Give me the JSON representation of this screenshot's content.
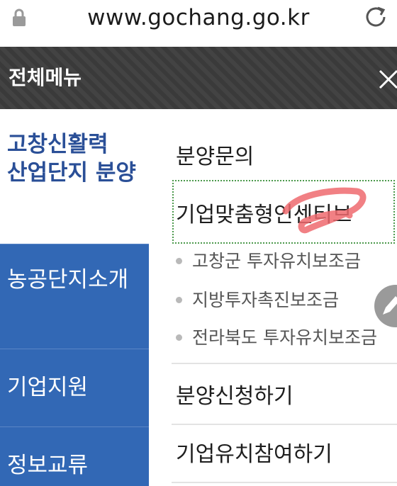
{
  "browser": {
    "url": "www.gochang.go.kr"
  },
  "menu": {
    "title": "전체메뉴"
  },
  "left_nav": {
    "active": "고창신활력 산업단지 분양",
    "items": [
      {
        "label": "농공단지소개"
      },
      {
        "label": "기업지원"
      },
      {
        "label": "정보교류"
      }
    ]
  },
  "right_nav": {
    "items": [
      {
        "label": "분양문의"
      },
      {
        "label": "기업맞춤형인센티브"
      },
      {
        "label": "분양신청하기"
      },
      {
        "label": "기업유치참여하기"
      }
    ],
    "subitems": [
      {
        "label": "고창군 투자유치보조금"
      },
      {
        "label": "지방투자촉진보조금"
      },
      {
        "label": "전라북도 투자유치보조금"
      }
    ]
  },
  "colors": {
    "header_bg": "#3d3d3d",
    "nav_blue": "#3268b5",
    "active_text": "#2a4f97",
    "annotation_red": "#ee6a6e",
    "highlight_green": "#4d9a4d"
  }
}
